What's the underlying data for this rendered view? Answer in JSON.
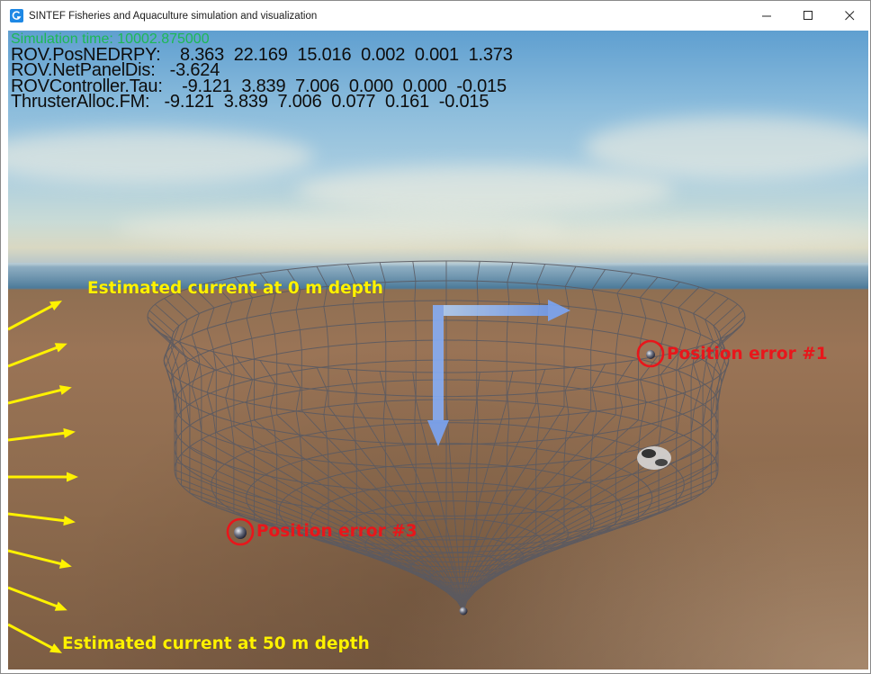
{
  "window": {
    "title": "SINTEF Fisheries and Aquaculture simulation and visualization",
    "icon": "sintef-app-icon",
    "controls": {
      "minimize": "—",
      "maximize": "☐",
      "close": "✕"
    }
  },
  "hud": {
    "sim_time": "Simulation time: 10002.875000",
    "lines": [
      "ROV.PosNEDRPY:    8.363  22.169  15.016  0.002  0.001  1.373",
      "ROV.NetPanelDis:   -3.624",
      "ROVController.Tau:    -9.121  3.839  7.006  0.000  0.000  -0.015",
      "ThrusterAlloc.FM:   -9.121  3.839  7.006  0.077  0.161  -0.015"
    ]
  },
  "annotations": {
    "current_top": "Estimated current at 0 m depth",
    "current_bottom": "Estimated current at 50 m depth",
    "pos_error_1": "Position error #1",
    "pos_error_3": "Position error #3"
  },
  "colors": {
    "sim_time_text": "#1db954",
    "hud_text": "#0d0d0d",
    "current_arrow": "#fff200",
    "position_error": "#e8161b",
    "net_mesh": "#5a5a62",
    "axis_arrow": "#7aa9ff"
  },
  "current_profile": {
    "description_depths": [
      0,
      50
    ],
    "arrow_count": 9
  }
}
